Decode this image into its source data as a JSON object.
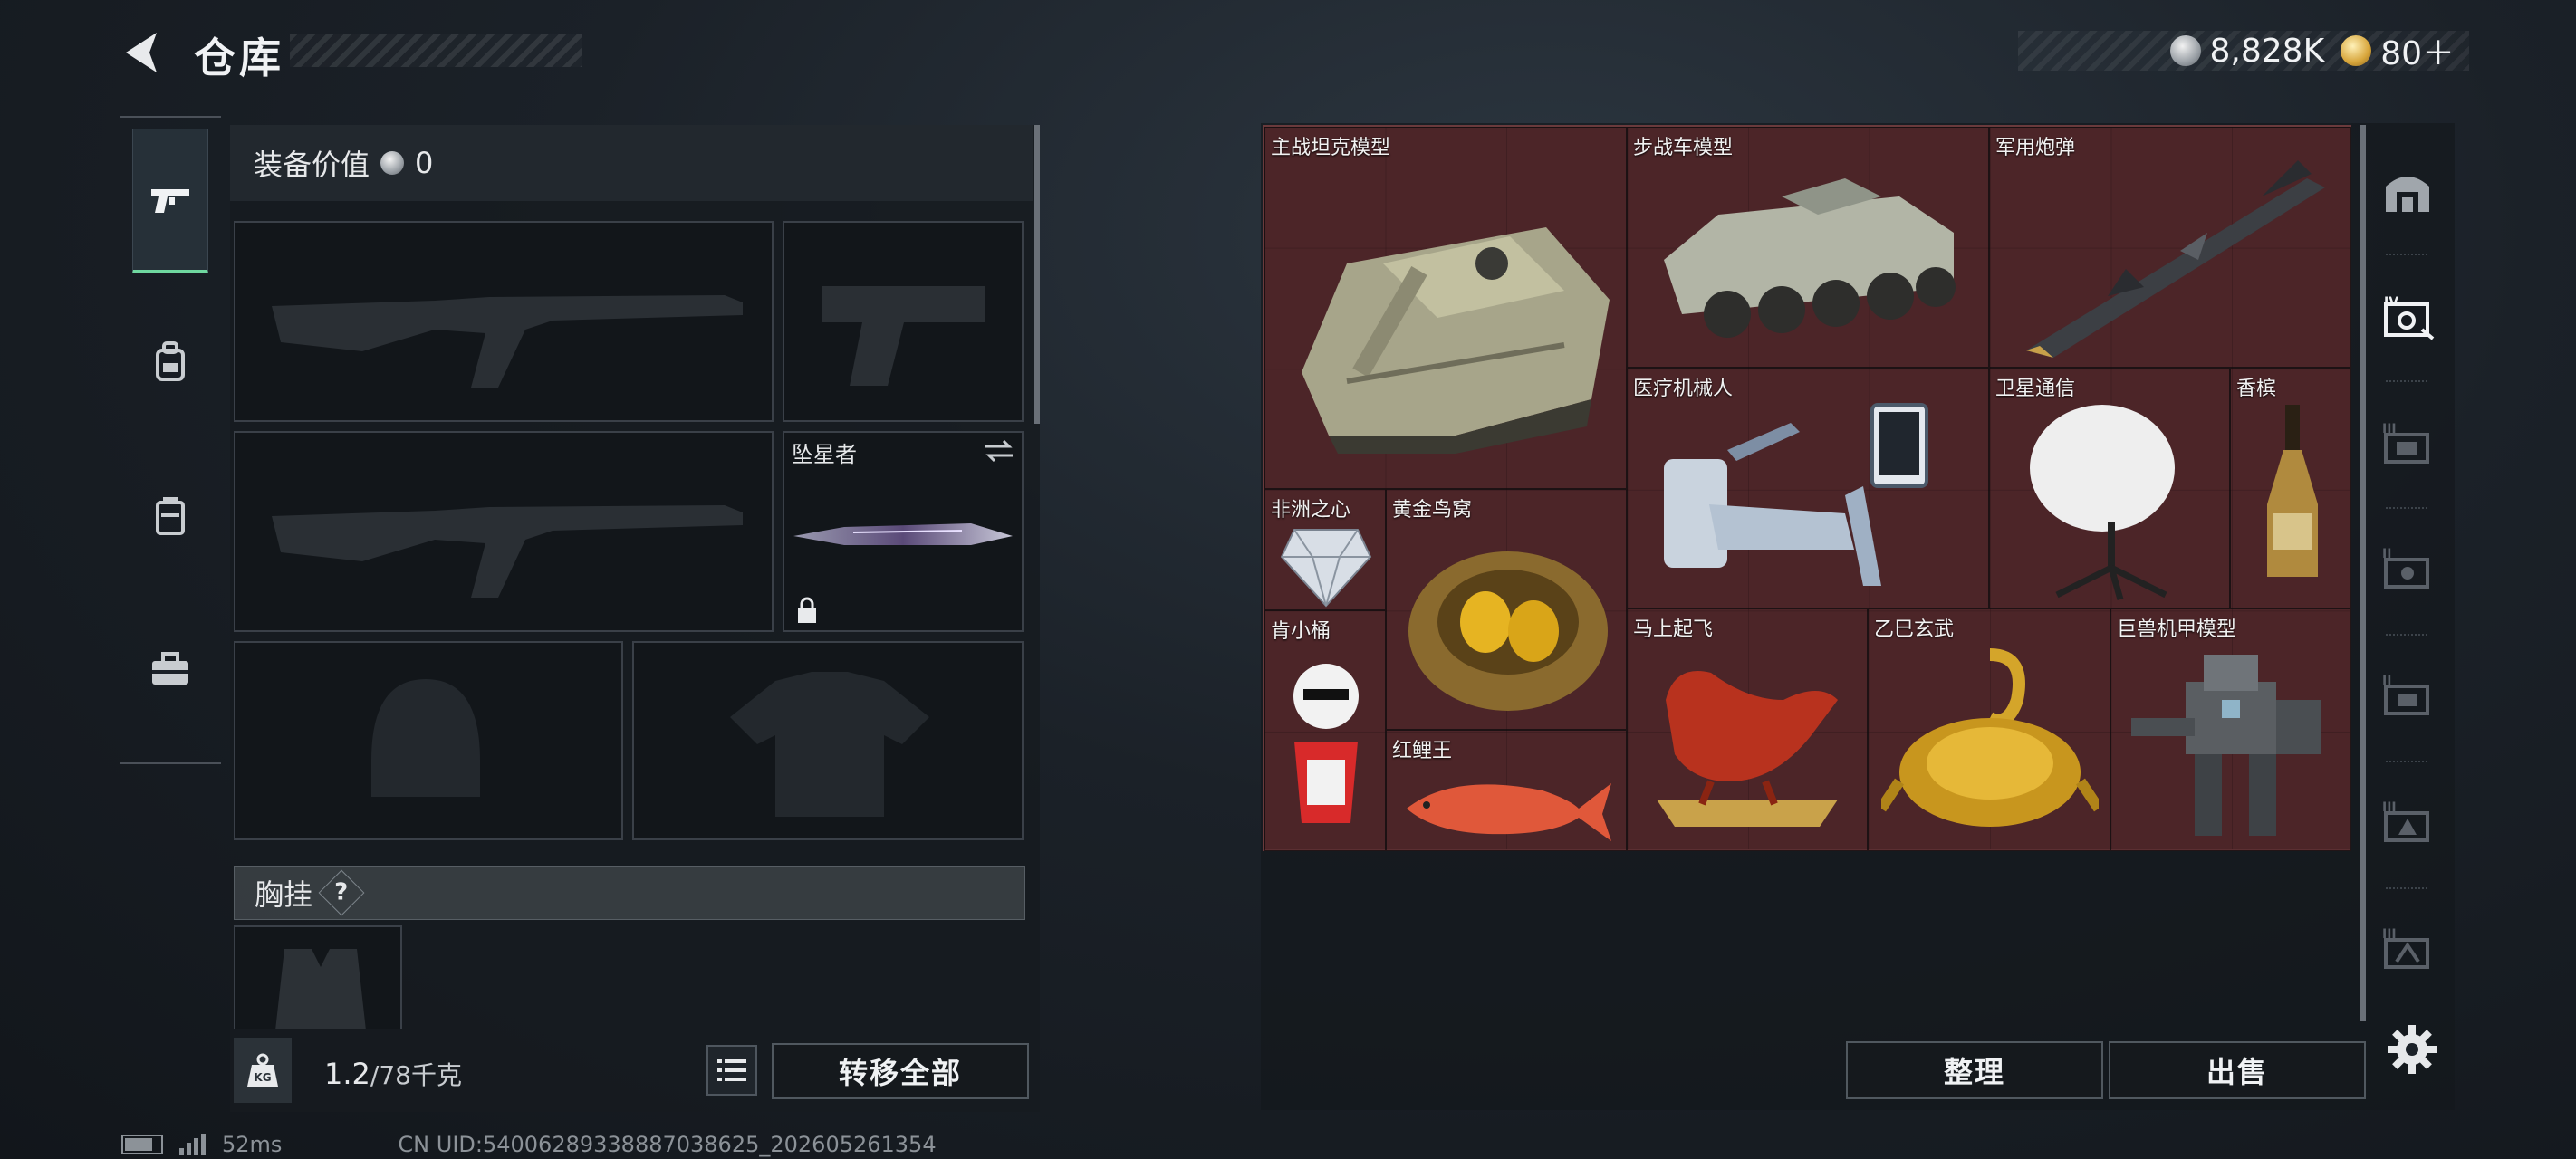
{
  "header": {
    "title": "仓库",
    "currency_silver": "8,828K",
    "currency_gold": "80＋"
  },
  "loadout": {
    "equip_value_label": "装备价值",
    "equip_value": "0",
    "melee_name": "坠星者",
    "chest_label": "胸挂",
    "help_mark": "?"
  },
  "footer": {
    "weight_current": "1.2",
    "weight_max": "/78千克",
    "transfer_all": "转移全部",
    "sort": "整理",
    "sell": "出售"
  },
  "status": {
    "ping": "52ms",
    "uid": "CN UID:5400628933888703​8625_202605261354"
  },
  "storage_items": [
    {
      "name": "主战坦克模型",
      "icon": "tank-icon"
    },
    {
      "name": "步战车模型",
      "icon": "ifv-icon"
    },
    {
      "name": "军用炮弹",
      "icon": "missile-icon"
    },
    {
      "name": "医疗机械人",
      "icon": "medical-robot-icon"
    },
    {
      "name": "卫星通信",
      "icon": "satellite-dish-icon"
    },
    {
      "name": "香槟",
      "icon": "champagne-icon"
    },
    {
      "name": "非洲之心",
      "icon": "diamond-icon"
    },
    {
      "name": "黄金鸟窝",
      "icon": "golden-nest-icon"
    },
    {
      "name": "肯小桶",
      "icon": "kfc-bucket-icon"
    },
    {
      "name": "红鲤王",
      "icon": "red-carp-icon"
    },
    {
      "name": "马上起飞",
      "icon": "red-horse-icon"
    },
    {
      "name": "乙巳玄武",
      "icon": "golden-tortoise-icon"
    },
    {
      "name": "巨兽机甲模型",
      "icon": "mech-icon"
    }
  ],
  "colors": {
    "grid_bg": "#4a2427",
    "accent_green": "#6fd8a0"
  }
}
